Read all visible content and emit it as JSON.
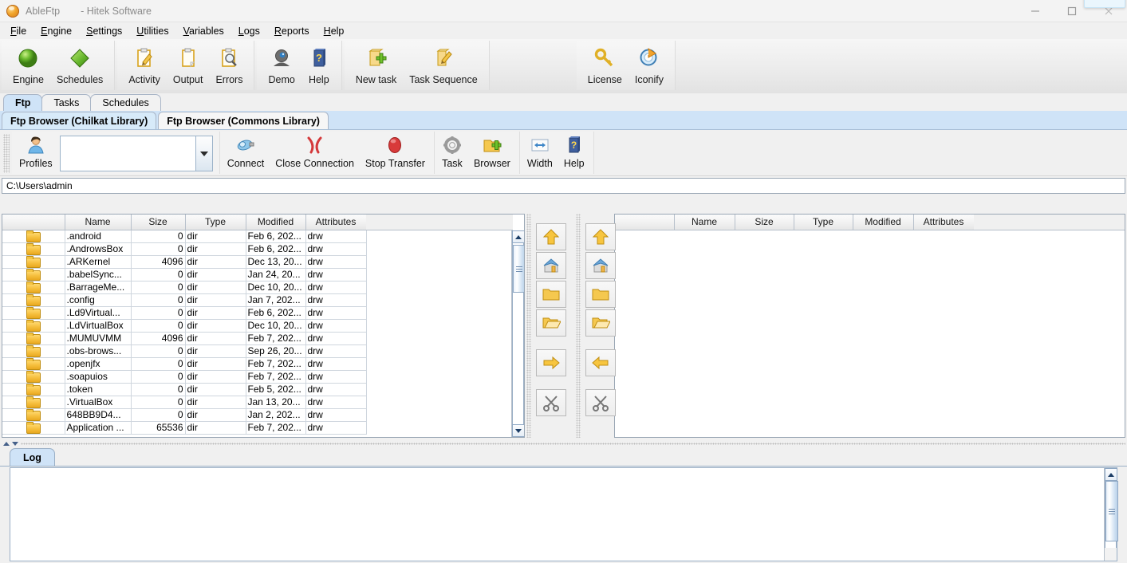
{
  "window": {
    "app_name": "AbleFtp",
    "subtitle": "- Hitek Software",
    "app_icon": "ableftp-logo-icon",
    "minimize_label": "minimize-icon",
    "maximize_label": "maximize-icon",
    "close_label": "close-icon"
  },
  "menubar": {
    "items": [
      {
        "label": "File",
        "mnemonic": "F"
      },
      {
        "label": "Engine",
        "mnemonic": "E"
      },
      {
        "label": "Settings",
        "mnemonic": "S"
      },
      {
        "label": "Utilities",
        "mnemonic": "U"
      },
      {
        "label": "Variables",
        "mnemonic": "V"
      },
      {
        "label": "Logs",
        "mnemonic": "L"
      },
      {
        "label": "Reports",
        "mnemonic": "R"
      },
      {
        "label": "Help",
        "mnemonic": "H"
      }
    ]
  },
  "main_toolbar": {
    "groups": [
      {
        "name": "engine-group",
        "buttons": [
          {
            "label": "Engine",
            "icon": "green-sphere-icon"
          },
          {
            "label": "Schedules",
            "icon": "green-diamond-icon"
          }
        ]
      },
      {
        "name": "monitor-group",
        "buttons": [
          {
            "label": "Activity",
            "icon": "clipboard-pencil-icon"
          },
          {
            "label": "Output",
            "icon": "clipboard-icon"
          },
          {
            "label": "Errors",
            "icon": "clipboard-magnifier-icon"
          }
        ]
      },
      {
        "name": "help-group",
        "buttons": [
          {
            "label": "Demo",
            "icon": "webcam-icon"
          },
          {
            "label": "Help",
            "icon": "blue-book-question-icon"
          }
        ]
      },
      {
        "name": "task-group",
        "buttons": [
          {
            "label": "New task",
            "icon": "new-task-plus-icon"
          },
          {
            "label": "Task Sequence",
            "icon": "task-sequence-icon"
          }
        ]
      }
    ],
    "right_group": {
      "name": "license-group",
      "buttons": [
        {
          "label": "License",
          "icon": "gold-key-icon"
        },
        {
          "label": "Iconify",
          "icon": "iconify-circle-arrow-icon"
        }
      ]
    }
  },
  "tabs": {
    "primary": [
      {
        "label": "Ftp",
        "selected": true
      },
      {
        "label": "Tasks",
        "selected": false
      },
      {
        "label": "Schedules",
        "selected": false
      }
    ],
    "secondary": [
      {
        "label": "Ftp Browser (Chilkat Library)",
        "selected": true
      },
      {
        "label": "Ftp Browser (Commons Library)",
        "selected": false
      }
    ]
  },
  "ftp_toolbar": {
    "profiles_label": "Profiles",
    "profiles_icon": "user-profile-icon",
    "profiles_value": "",
    "profiles_placeholder": "",
    "dropdown_icon": "chevron-down-icon",
    "buttons": [
      {
        "label": "Connect",
        "icon": "connect-plug-icon"
      },
      {
        "label": "Close Connection",
        "icon": "red-x-icon"
      },
      {
        "label": "Stop Transfer",
        "icon": "red-stop-icon"
      },
      {
        "label": "Task",
        "icon": "gear-icon"
      },
      {
        "label": "Browser",
        "icon": "folder-plus-icon"
      },
      {
        "label": "Width",
        "icon": "width-arrows-icon"
      },
      {
        "label": "Help",
        "icon": "blue-book-question-icon"
      }
    ]
  },
  "local_panel": {
    "path": "C:\\Users\\admin",
    "columns": [
      "",
      "Name",
      "Size",
      "Type",
      "Modified",
      "Attributes"
    ],
    "rows": [
      {
        "icon": "folder-icon",
        "name": ".android",
        "size": "0",
        "type": "dir",
        "modified": "Feb 6, 202...",
        "attributes": "drw"
      },
      {
        "icon": "folder-icon",
        "name": ".AndrowsBox",
        "size": "0",
        "type": "dir",
        "modified": "Feb 6, 202...",
        "attributes": "drw"
      },
      {
        "icon": "folder-icon",
        "name": ".ARKernel",
        "size": "4096",
        "type": "dir",
        "modified": "Dec 13, 20...",
        "attributes": "drw"
      },
      {
        "icon": "folder-icon",
        "name": ".babelSync...",
        "size": "0",
        "type": "dir",
        "modified": "Jan 24, 20...",
        "attributes": "drw"
      },
      {
        "icon": "folder-icon",
        "name": ".BarrageMe...",
        "size": "0",
        "type": "dir",
        "modified": "Dec 10, 20...",
        "attributes": "drw"
      },
      {
        "icon": "folder-icon",
        "name": ".config",
        "size": "0",
        "type": "dir",
        "modified": "Jan 7, 202...",
        "attributes": "drw"
      },
      {
        "icon": "folder-icon",
        "name": ".Ld9Virtual...",
        "size": "0",
        "type": "dir",
        "modified": "Feb 6, 202...",
        "attributes": "drw"
      },
      {
        "icon": "folder-icon",
        "name": ".LdVirtualBox",
        "size": "0",
        "type": "dir",
        "modified": "Dec 10, 20...",
        "attributes": "drw"
      },
      {
        "icon": "folder-icon",
        "name": ".MUMUVMM",
        "size": "4096",
        "type": "dir",
        "modified": "Feb 7, 202...",
        "attributes": "drw"
      },
      {
        "icon": "folder-icon",
        "name": ".obs-brows...",
        "size": "0",
        "type": "dir",
        "modified": "Sep 26, 20...",
        "attributes": "drw"
      },
      {
        "icon": "folder-icon",
        "name": ".openjfx",
        "size": "0",
        "type": "dir",
        "modified": "Feb 7, 202...",
        "attributes": "drw"
      },
      {
        "icon": "folder-icon",
        "name": ".soapuios",
        "size": "0",
        "type": "dir",
        "modified": "Feb 7, 202...",
        "attributes": "drw"
      },
      {
        "icon": "folder-icon",
        "name": ".token",
        "size": "0",
        "type": "dir",
        "modified": "Feb 5, 202...",
        "attributes": "drw"
      },
      {
        "icon": "folder-icon",
        "name": ".VirtualBox",
        "size": "0",
        "type": "dir",
        "modified": "Jan 13, 20...",
        "attributes": "drw"
      },
      {
        "icon": "folder-icon",
        "name": "648BB9D4...",
        "size": "0",
        "type": "dir",
        "modified": "Jan 2, 202...",
        "attributes": "drw"
      },
      {
        "icon": "folder-icon",
        "name": "Application ...",
        "size": "65536",
        "type": "dir",
        "modified": "Feb 7, 202...",
        "attributes": "drw"
      }
    ]
  },
  "remote_panel": {
    "path": "",
    "columns": [
      "",
      "Name",
      "Size",
      "Type",
      "Modified",
      "Attributes"
    ],
    "rows": []
  },
  "transfer_buttons": {
    "left_column": [
      {
        "icon": "up-arrow-icon"
      },
      {
        "icon": "home-icon"
      },
      {
        "icon": "folder-icon"
      },
      {
        "icon": "open-folder-icon"
      },
      {
        "icon": "right-arrow-icon"
      },
      {
        "icon": "scissors-icon"
      }
    ],
    "right_column": [
      {
        "icon": "up-arrow-icon"
      },
      {
        "icon": "home-icon"
      },
      {
        "icon": "folder-icon"
      },
      {
        "icon": "open-folder-icon"
      },
      {
        "icon": "left-arrow-icon"
      },
      {
        "icon": "scissors-icon"
      }
    ]
  },
  "log": {
    "tab_label": "Log",
    "content": ""
  }
}
